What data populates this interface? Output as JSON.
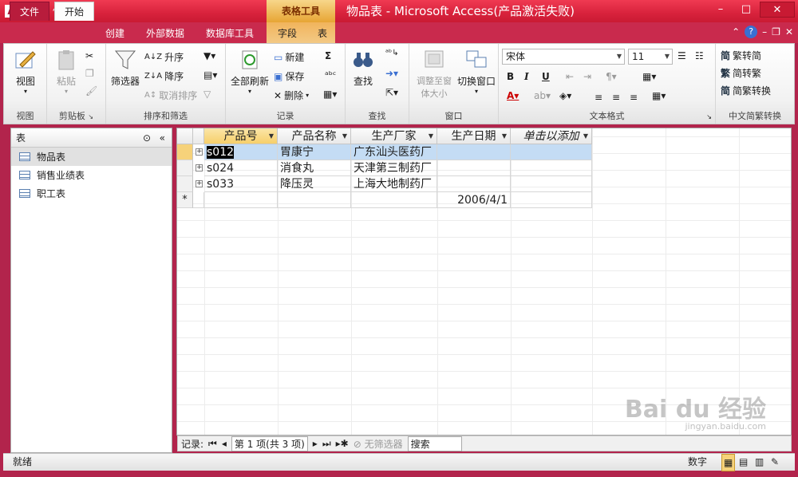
{
  "window": {
    "title": "物品表 - Microsoft Access(产品激活失败)",
    "context_tab_header": "表格工具",
    "minimize": "–",
    "maximize": "□",
    "close": "✕"
  },
  "tabs": {
    "file": "文件",
    "home": "开始",
    "create": "创建",
    "external": "外部数据",
    "dbtools": "数据库工具",
    "fields": "字段",
    "table": "表"
  },
  "ribbon": {
    "views": {
      "view": "视图",
      "label": "视图"
    },
    "clipboard": {
      "paste": "粘贴",
      "label": "剪贴板"
    },
    "sort": {
      "filter": "筛选器",
      "asc": "升序",
      "desc": "降序",
      "remove_sort": "取消排序",
      "label": "排序和筛选"
    },
    "records": {
      "refresh": "全部刷新",
      "new": "新建",
      "save": "保存",
      "delete": "删除",
      "label": "记录"
    },
    "find": {
      "find": "查找",
      "label": "查找"
    },
    "window": {
      "adjust": "调整至窗体大小",
      "switch": "切换窗口",
      "label": "窗口"
    },
    "text": {
      "font": "宋体",
      "size": "11",
      "label": "文本格式"
    },
    "chinese": {
      "to_simple": "繁转简",
      "to_trad": "简转繁",
      "convert": "简繁转换",
      "label": "中文简繁转换"
    }
  },
  "nav": {
    "header": "表",
    "items": [
      "物品表",
      "销售业绩表",
      "职工表"
    ]
  },
  "sheet": {
    "columns": [
      "产品号",
      "产品名称",
      "生产厂家",
      "生产日期",
      "单击以添加"
    ],
    "rows": [
      [
        "s012",
        "胃康宁",
        "广东汕头医药厂",
        ""
      ],
      [
        "s024",
        "消食丸",
        "天津第三制药厂",
        ""
      ],
      [
        "s033",
        "降压灵",
        "上海大地制药厂",
        ""
      ]
    ],
    "new_row_date": "2006/4/1",
    "new_row_marker": "*"
  },
  "record_nav": {
    "label": "记录:",
    "position": "第 1 项(共 3 项)",
    "filter": "无筛选器",
    "search": "搜索"
  },
  "status": {
    "left": "就绪",
    "mode": "数字"
  },
  "watermark": {
    "brand": "Bai du 经验",
    "url": "jingyan.baidu.com"
  }
}
